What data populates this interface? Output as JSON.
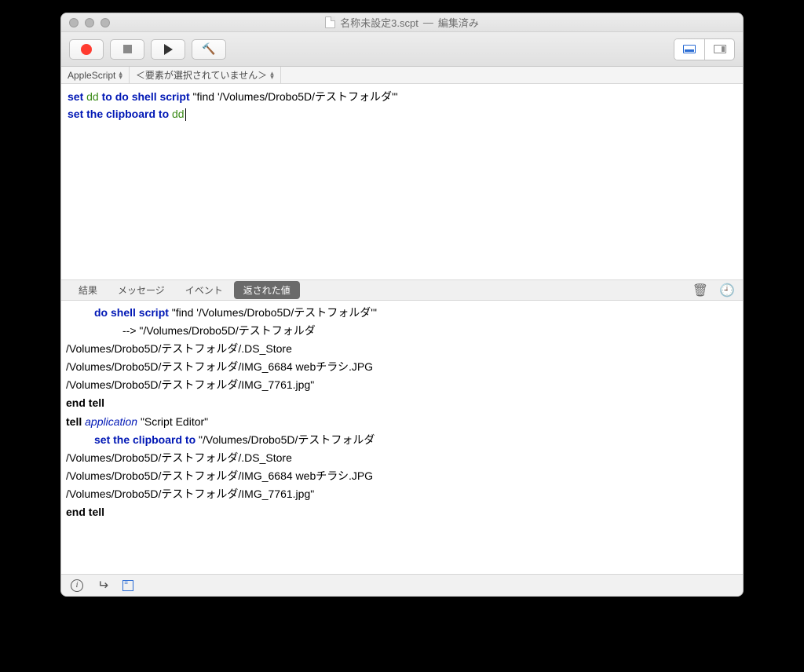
{
  "title": {
    "filename": "名称未設定3.scpt",
    "sep": "—",
    "status": "編集済み"
  },
  "selector": {
    "language": "AppleScript",
    "hint": "＜要素が選択されていません＞"
  },
  "code": {
    "l1_set": "set",
    "l1_var1": "dd",
    "l1_to": "to",
    "l1_cmd": "do shell script",
    "l1_str": "\"find '/Volumes/Drobo5D/テストフォルダ'\"",
    "l2_set": "set the clipboard to",
    "l2_var": "dd"
  },
  "tabs": {
    "result": "結果",
    "message": "メッセージ",
    "event": "イベント",
    "returned": "返された値"
  },
  "log": {
    "cmd1": "do shell script",
    "cmd1_arg": " \"find '/Volumes/Drobo5D/テストフォルダ'\"",
    "arrow": "-->",
    "out_open": " \"/Volumes/Drobo5D/テストフォルダ",
    "out2": "/Volumes/Drobo5D/テストフォルダ/.DS_Store",
    "out3": "/Volumes/Drobo5D/テストフォルダ/IMG_6684 webチラシ.JPG",
    "out4": "/Volumes/Drobo5D/テストフォルダ/IMG_7761.jpg\"",
    "endtell1": "end tell",
    "tell": "tell",
    "app": "application",
    "appname": " \"Script Editor\"",
    "cmd2": "set the clipboard to",
    "cmd2_arg": " \"/Volumes/Drobo5D/テストフォルダ",
    "out5": "/Volumes/Drobo5D/テストフォルダ/.DS_Store",
    "out6": "/Volumes/Drobo5D/テストフォルダ/IMG_6684 webチラシ.JPG",
    "out7": "/Volumes/Drobo5D/テストフォルダ/IMG_7761.jpg\"",
    "endtell2": "end tell"
  }
}
